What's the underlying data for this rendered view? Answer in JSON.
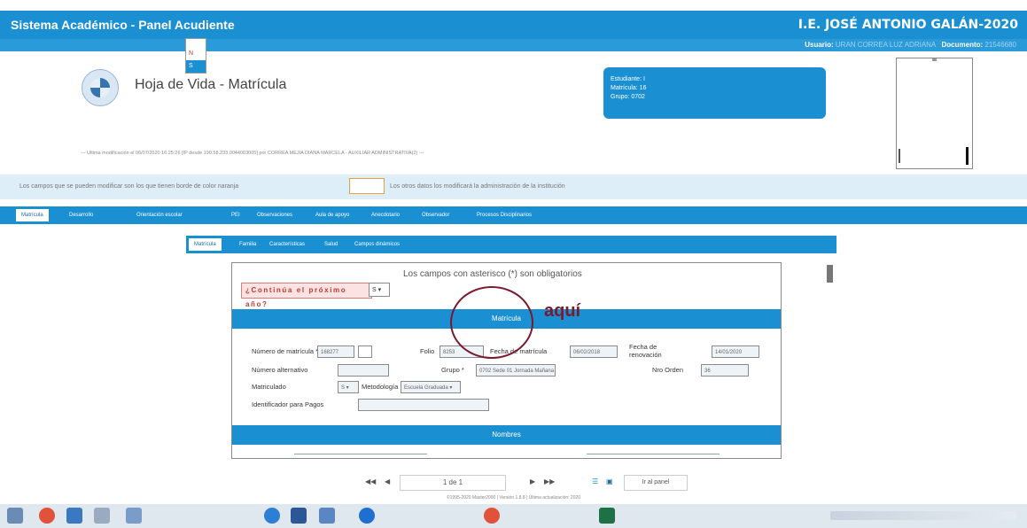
{
  "header": {
    "app_title": "Sistema Académico - Panel Acudiente",
    "school": "I.E. JOSÉ ANTONIO GALÁN-2020"
  },
  "userbar": {
    "user_label": "Usuario:",
    "user_value": "URAN CORREA LUZ ADRIANA",
    "doc_label": "Documento:",
    "doc_value": "21546680"
  },
  "page": {
    "heading": "Hoja de Vida - Matrícula",
    "last_modified": "--- Ultima modificación el 06/07/2020 16:25:26 [IP desde 190.58.233.0044003005] por CORREA MEJIA DIANA MARCELA - AUXILIAR ADMINISTRATIVA(2) ---"
  },
  "student_box": {
    "student": "Estudiante: I",
    "matricula": "Matrícula: 16",
    "grupo": "Grupo: 0702"
  },
  "infobar": {
    "text_left": "Los campos que se pueden modificar son los que tienen borde de color naranja",
    "text_right": "Los otros datos los modificará la administración de la institución"
  },
  "main_tabs": [
    {
      "label": "Matrícula",
      "active": true
    },
    {
      "label": "Desarrollo",
      "active": false
    },
    {
      "label": "Orientación escolar",
      "active": false
    },
    {
      "label": "PEI",
      "active": false
    },
    {
      "label": "Observaciones",
      "active": false
    },
    {
      "label": "Aula de apoyo",
      "active": false
    },
    {
      "label": "Anecdotario",
      "active": false
    },
    {
      "label": "Observador",
      "active": false
    },
    {
      "label": "Procesos Disciplinarios",
      "active": false
    }
  ],
  "sub_tabs": [
    {
      "label": "Matrícula",
      "active": true
    },
    {
      "label": "Familia",
      "active": false
    },
    {
      "label": "Características",
      "active": false
    },
    {
      "label": "Salud",
      "active": false
    },
    {
      "label": "Campos dinámicos",
      "active": false
    }
  ],
  "form": {
    "required_note": "Los campos con asterisco (*) son obligatorios",
    "question": "¿Continúa el próximo año?",
    "question_value": "S",
    "dropdown_options": [
      "N",
      "S"
    ],
    "section_matricula": "Matrícula",
    "section_nombres": "Nombres",
    "fields": {
      "numero_matricula_label": "Número de matrícula *",
      "numero_matricula_value": "168277",
      "folio_label": "Folio",
      "folio_value": "8253",
      "fecha_matricula_label": "Fecha de matrícula",
      "fecha_matricula_value": "06/02/2018",
      "fecha_renovacion_label": "Fecha de renovación",
      "fecha_renovacion_value": "14/01/2020",
      "numero_alternativo_label": "Número alternativo",
      "grupo_label": "Grupo *",
      "grupo_value": "0702 Sede 01 Jornada Mañana",
      "nro_orden_label": "Nro Orden",
      "nro_orden_value": "36",
      "matriculado_label": "Matriculado",
      "matriculado_value": "S",
      "metodologia_label": "Metodología",
      "metodologia_value": "Escuela Graduada",
      "identificador_label": "Identificador para Pagos"
    }
  },
  "annotation": {
    "text": "aquí"
  },
  "pager": {
    "page_label": "1 de 1",
    "go_panel": "Ir al panel"
  },
  "footer": {
    "text": "©1995-2020 Master2000 | Versión 1.8.8 | Última actualización: 2020"
  },
  "colors": {
    "primary": "#1a8fd1",
    "info_bg": "#ddeef8",
    "required_border": "#e27a7a",
    "annotation": "#7a1a2e"
  }
}
